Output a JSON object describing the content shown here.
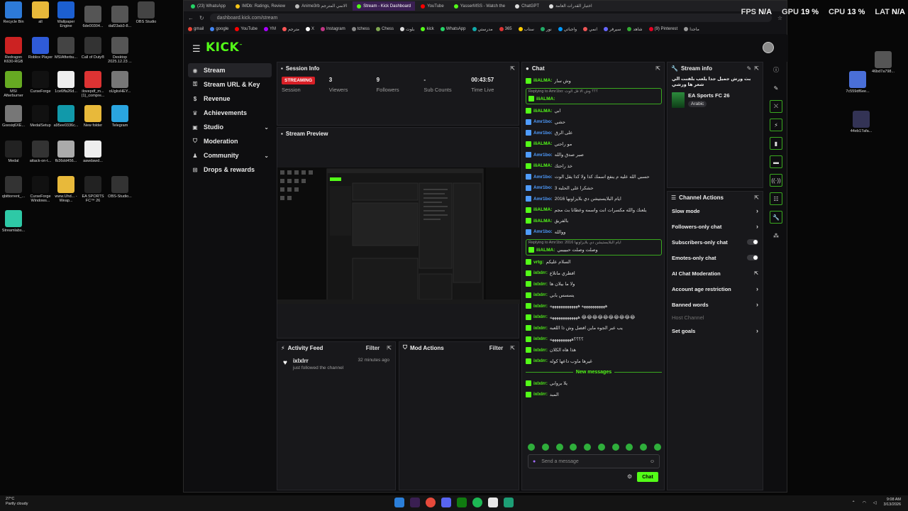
{
  "overlay": {
    "fps_label": "FPS",
    "fps_value": "N/A",
    "gpu_label": "GPU",
    "gpu_value": "19 %",
    "cpu_label": "CPU",
    "cpu_value": "13 %",
    "lat_label": "LAT",
    "lat_value": "N/A"
  },
  "desktop_icons": [
    "Recycle Bin",
    "all",
    "Wallpaper Engine",
    "6de00304...",
    "daf23ab3-8...",
    "OBS Studio",
    "Redragon K630-RGB",
    "Roblox Player",
    "MSIAfterbu...",
    "Call of Duty®",
    "Desktop 2025.12.23 ...",
    "MSI Afterburner",
    "CurseForge",
    "1ce6ffa26d...",
    "ilovepdf_m... (1)_compre...",
    "oUgkvHEY...",
    "Gxesiq6XE...",
    "MedalSetup",
    "a95ee0336c...",
    "New folder",
    "Telegram",
    "Medal",
    "attack-on-t...",
    "fb36dd456...",
    "aawdawd...",
    "qbittorrent_...",
    "CurseForge Windows...",
    "www.Uhd... - Weap...",
    "EA SPORTS FC™ 26",
    "OBS-Studio...",
    "Streamlabs...",
    "46bd7a798...",
    "7c559df6ee...",
    "44eb17afa..."
  ],
  "browser": {
    "tabs": [
      "(23) WhatsApp",
      "IMDb: Ratings, Review",
      "Anime3rb الانمي المترجم",
      "Stream - Kick Dashboard",
      "YouTube",
      "YasserMSS - Watch the",
      "ChatGPT",
      "اختبار القدرات العامة"
    ],
    "url": "dashboard.kick.com/stream",
    "bookmarks": [
      "gmail",
      "google",
      "YouTube",
      "YM",
      "مترجم",
      "X",
      "Instagram",
      "tchess",
      "Chess",
      "بلوت",
      "kick",
      "WhatsApp",
      "مدرستي",
      "365",
      "سناب",
      "نور",
      "واجباتي",
      "انمي",
      "سيرفر",
      "شاهد",
      "(9) Pinterest",
      "ماجدا"
    ]
  },
  "kick": {
    "logo": "KICK",
    "nav": [
      {
        "label": "Stream",
        "icon": "stream-icon"
      },
      {
        "label": "Stream URL & Key",
        "icon": "key-icon"
      },
      {
        "label": "Revenue",
        "icon": "dollar-icon"
      },
      {
        "label": "Achievements",
        "icon": "trophy-icon"
      },
      {
        "label": "Studio",
        "icon": "studio-icon"
      },
      {
        "label": "Moderation",
        "icon": "shield-icon"
      },
      {
        "label": "Community",
        "icon": "community-icon"
      },
      {
        "label": "Drops & rewards",
        "icon": "gift-icon"
      }
    ],
    "session": {
      "title": "Session Info",
      "status": "STREAMING",
      "session_label": "Session",
      "viewers_value": "3",
      "viewers_label": "Viewers",
      "followers_value": "9",
      "followers_label": "Followers",
      "subs_value": "-",
      "subs_label": "Sub Counts",
      "time_value": "00:43:57",
      "time_label": "Time Live"
    },
    "preview": {
      "title": "Stream Preview"
    },
    "activity": {
      "title": "Activity Feed",
      "filter": "Filter",
      "user": "ixlxlrr",
      "text": "just followed the channel",
      "time": "32 minutes ago"
    },
    "mod": {
      "title": "Mod Actions",
      "filter": "Filter"
    },
    "chat": {
      "title": "Chat",
      "messages": [
        {
          "user": "iliALMA:",
          "text": "وش سار",
          "color": "#53fc18"
        },
        {
          "reply": "Replying to Amr1bo: ؟؟؟ وش الا قل الوت",
          "user": "iliALMA:",
          "text": "",
          "color": "#53fc18"
        },
        {
          "user": "iliALMA:",
          "text": "ابي",
          "color": "#53fc18"
        },
        {
          "user": "Amr1bo:",
          "text": "حشي",
          "color": "#4f9cff"
        },
        {
          "user": "Amr1bo:",
          "text": "على الرق",
          "color": "#4f9cff"
        },
        {
          "user": "iliALMA:",
          "text": "مو راحتي",
          "color": "#53fc18"
        },
        {
          "user": "Amr1bo:",
          "text": "صبر صدق والله",
          "color": "#4f9cff"
        },
        {
          "user": "iliALMA:",
          "text": "خذ راحتك",
          "color": "#53fc18"
        },
        {
          "user": "Amr1bo:",
          "text": "حسبي الله عليه م ينفع اسمك كذا ولا كذا يقل الوت",
          "color": "#4f9cff"
        },
        {
          "user": "Amr1bo:",
          "text": "حشكرا على الحلبه 3",
          "color": "#4f9cff"
        },
        {
          "user": "Amr1bo:",
          "text": "ايام البلايستيشن دي بلايزاونها 2016",
          "color": "#4f9cff"
        },
        {
          "user": "iliALMA:",
          "text": "يلعنك والله مكسرات انت واسمه وعطانا بث مجم",
          "color": "#53fc18"
        },
        {
          "user": "iliALMA:",
          "text": "بالفريق",
          "color": "#53fc18"
        },
        {
          "user": "Amr1bo:",
          "text": "ووالله",
          "color": "#4f9cff"
        },
        {
          "reply": "Replying to Amr1bo: ايام البلايستيشن دي بلايزاونها 2016",
          "user": "iliALMA:",
          "text": "وصلت وصلت حبيييبي",
          "color": "#53fc18"
        },
        {
          "user": "vrtg:",
          "text": "السلام عليكم",
          "color": "#53fc18"
        },
        {
          "user": "ixlxlrr:",
          "text": "افطري ماتلاع",
          "color": "#53fc18"
        },
        {
          "user": "ixlxlrr:",
          "text": "ولا ما بيلان ها",
          "color": "#53fc18"
        },
        {
          "user": "ixlxlrr:",
          "text": "يسسس بابي",
          "color": "#53fc18"
        },
        {
          "user": "ixlxlrr:",
          "text": "هههههههههههه هههههههههههههه",
          "color": "#53fc18"
        },
        {
          "user": "ixlxlrr:",
          "text": "هههههههههههههه 😂😂😂😂😂😂😂😂😂😂",
          "color": "#53fc18"
        },
        {
          "user": "ixlxlrr:",
          "text": "يب عبر الجوه ماين افضل وش ذا اللعبه",
          "color": "#53fc18"
        },
        {
          "user": "ixlxlrr:",
          "text": "؟؟؟؟ههههههههههه",
          "color": "#53fc18"
        },
        {
          "user": "ixlxlrr:",
          "text": "هذا هاه الكلان",
          "color": "#53fc18"
        },
        {
          "user": "ixlxlrr:",
          "text": "غيرها ماوب داعها كوله",
          "color": "#53fc18"
        }
      ],
      "new_messages": "New messages",
      "new": [
        {
          "user": "ixlxlrr:",
          "text": "يلا بروابي",
          "color": "#53fc18"
        },
        {
          "user": "ixlxlrr:",
          "text": "المبد",
          "color": "#53fc18"
        }
      ],
      "placeholder": "Send a message",
      "send": "Chat"
    },
    "stream_info": {
      "title": "Stream info",
      "stream_title": "بث ورش جميل جدا يلعب بلفنت الي شعر ها ورشي",
      "game": "EA Sports FC 26",
      "language": "Arabic"
    },
    "actions": {
      "title": "Channel Actions",
      "items": [
        "Slow mode",
        "Followers-only chat",
        "Subscribers-only chat",
        "Emotes-only chat",
        "AI Chat Moderation",
        "Account age restriction",
        "Banned words",
        "Host Channel",
        "Set goals"
      ]
    }
  },
  "taskbar": {
    "temp": "27°C",
    "weather": "Partly cloudy",
    "time": "9:08 AM",
    "date": "3/13/2026"
  }
}
